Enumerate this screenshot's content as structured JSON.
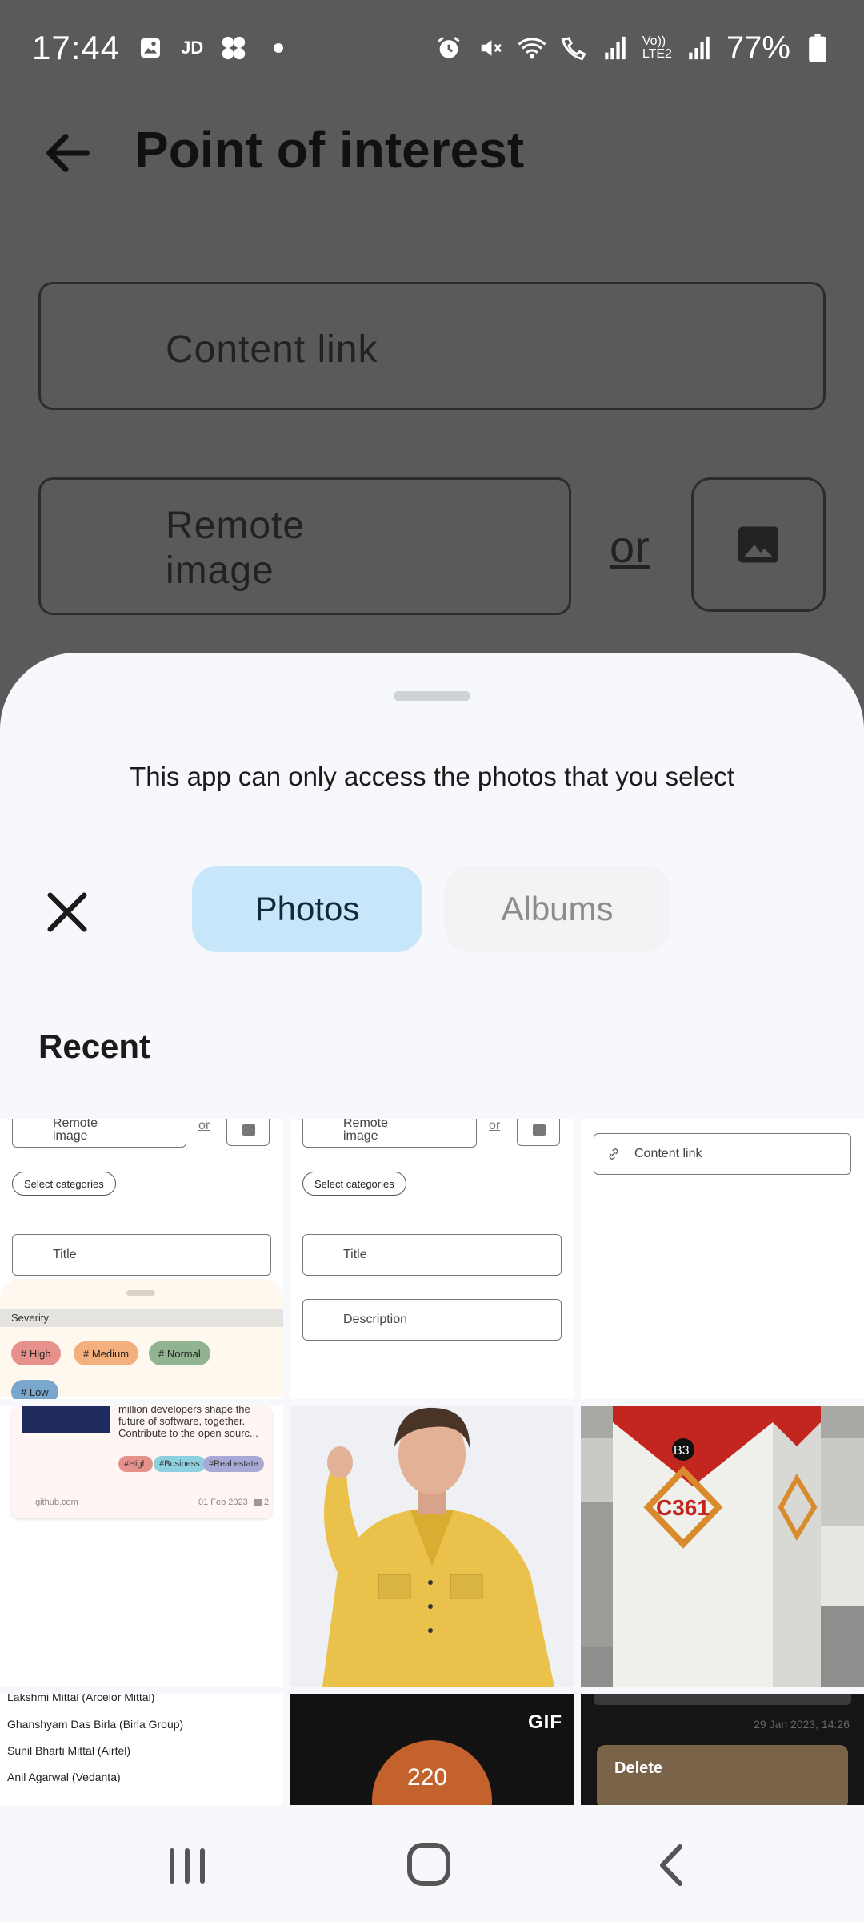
{
  "status_bar": {
    "time": "17:44",
    "battery": "77%",
    "left_icons": [
      "gallery-icon",
      "jd-icon",
      "fan-icon",
      "dot-icon"
    ],
    "right_icons": [
      "alarm-icon",
      "mute-icon",
      "wifi-icon",
      "wifi-call-icon",
      "signal-icon",
      "volte-icon",
      "signal-icon-2",
      "battery-icon"
    ],
    "jd_label": "JD",
    "volte_label": "Vo))\nLTE2"
  },
  "app": {
    "title": "Point of interest",
    "content_link_label": "Content link",
    "remote_image_label": "Remote image",
    "or_label": "or"
  },
  "sheet": {
    "notice": "This app can only access the photos that you select",
    "tabs": [
      {
        "label": "Photos",
        "selected": true
      },
      {
        "label": "Albums",
        "selected": false
      }
    ],
    "section_title": "Recent"
  },
  "thumbnails": {
    "t1": {
      "remote_image": "Remote image",
      "or": "or",
      "select_categories": "Select categories",
      "title": "Title",
      "severity": "Severity",
      "chips": [
        "# High",
        "# Medium",
        "# Normal",
        "# Low"
      ]
    },
    "t2": {
      "remote_image": "Remote image",
      "or": "or",
      "select_categories": "Select categories",
      "title": "Title",
      "description": "Description"
    },
    "t3": {
      "content_link": "Content link"
    },
    "t4": {
      "text": "million developers shape the future of software, together. Contribute to the open sourc...",
      "tags": [
        "#High",
        "#Business",
        "#Real estate"
      ],
      "link": "github.com",
      "date": "01 Feb 2023",
      "comments": "2"
    },
    "t6": {
      "labels": [
        "B3",
        "C361"
      ]
    },
    "t7": {
      "names": [
        "Lakshmi Mittal (Arcelor Mittal)",
        "Ghanshyam Das Birla (Birla Group)",
        "Sunil Bharti Mittal (Airtel)",
        "Anil Agarwal (Vedanta)"
      ]
    },
    "t8": {
      "badge": "GIF",
      "text": "220"
    },
    "t9": {
      "date": "29 Jan 2023, 14:26",
      "delete_label": "Delete"
    }
  },
  "colors": {
    "scrim": "#5a5a5a",
    "sheet_bg": "#f7f8fb",
    "tab_selected_bg": "#c8e6fa",
    "tab_unselected_text": "#8c8c8c"
  }
}
